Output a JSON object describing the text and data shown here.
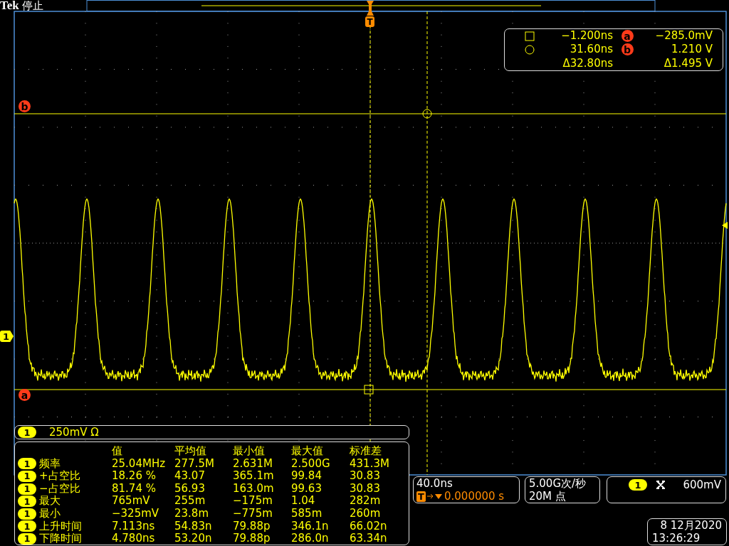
{
  "header": {
    "brand": "Tek",
    "status": "停止"
  },
  "trigger_marker": "T",
  "channel_marker": "1",
  "cursor_labels": [
    {
      "kind": "b",
      "label": "b"
    },
    {
      "kind": "a",
      "label": "a"
    }
  ],
  "cursor_readout": {
    "rows": [
      {
        "kind": "square",
        "time": "−1.200ns",
        "marker": "a",
        "value": "−285.0mV"
      },
      {
        "kind": "circle",
        "time": "31.60ns",
        "marker": "b",
        "value": "1.210 V"
      },
      {
        "kind": "delta",
        "time": "Δ32.80ns",
        "value": "Δ1.495 V"
      }
    ]
  },
  "channel_bar": {
    "channel": "1",
    "scale": "250mV Ω"
  },
  "measurements": {
    "columns": [
      "值",
      "平均值",
      "最小值",
      "最大值",
      "标准差"
    ],
    "rows": [
      {
        "channel": "1",
        "name": "频率",
        "values": [
          "25.04MHz",
          "277.5M",
          "2.631M",
          "2.500G",
          "431.3M"
        ]
      },
      {
        "channel": "1",
        "name": "+占空比",
        "values": [
          "18.26 %",
          "43.07",
          "365.1m",
          "99.84",
          "30.83"
        ]
      },
      {
        "channel": "1",
        "name": "−占空比",
        "values": [
          "81.74 %",
          "56.93",
          "163.0m",
          "99.63",
          "30.83"
        ]
      },
      {
        "channel": "1",
        "name": "最大",
        "values": [
          "765mV",
          "255m",
          "−175m",
          "1.04",
          "282m"
        ]
      },
      {
        "channel": "1",
        "name": "最小",
        "values": [
          "−325mV",
          "23.8m",
          "−775m",
          "585m",
          "260m"
        ]
      },
      {
        "channel": "1",
        "name": "上升时间",
        "values": [
          "7.113ns",
          "54.83n",
          "79.88p",
          "346.1n",
          "66.02n"
        ]
      },
      {
        "channel": "1",
        "name": "下降时间",
        "values": [
          "4.780ns",
          "53.20n",
          "79.88p",
          "286.0n",
          "63.34n"
        ]
      }
    ]
  },
  "timebase": {
    "scale": "40.0ns",
    "trigger_badge": "T",
    "position": "0.000000 s"
  },
  "acquisition": {
    "sample_rate": "5.00G次/秒",
    "record_length": "20M 点"
  },
  "trigger": {
    "channel": "1",
    "level": "600mV"
  },
  "datetime": {
    "date": "8 12月2020",
    "time": "13:26:29"
  }
}
